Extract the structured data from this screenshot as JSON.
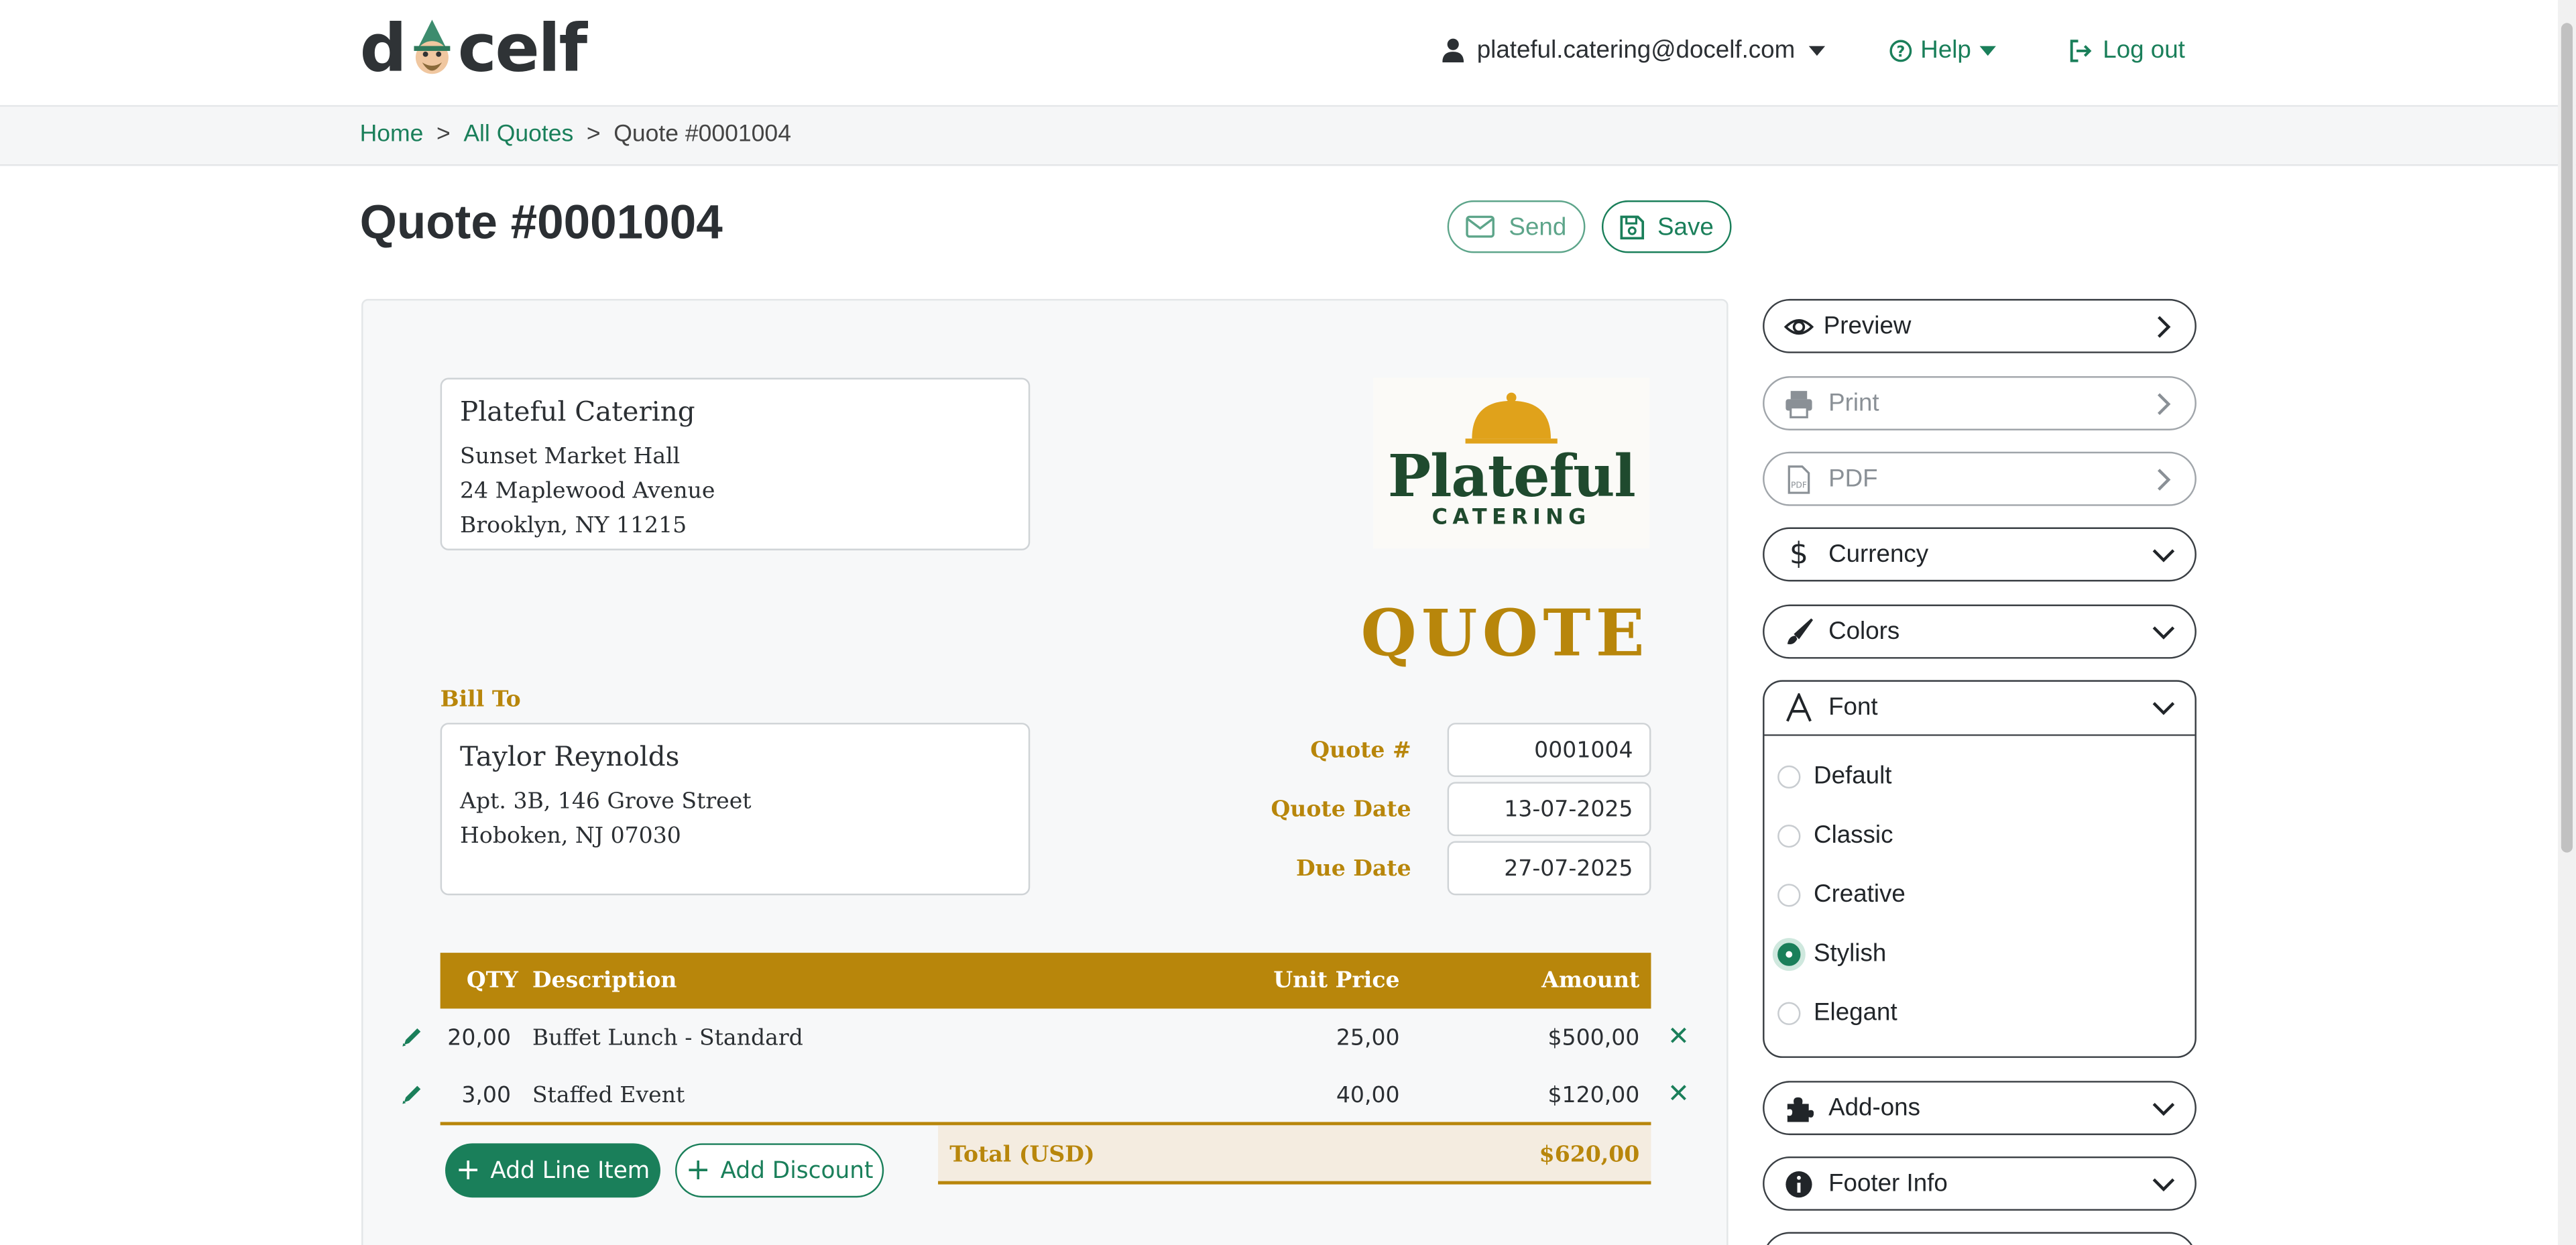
{
  "header": {
    "logo_left": "d",
    "logo_right": "celf",
    "user_email": "plateful.catering@docelf.com",
    "help_label": "Help",
    "logout_label": "Log out"
  },
  "breadcrumb": {
    "home": "Home",
    "all_quotes": "All Quotes",
    "current": "Quote #0001004",
    "separator": ">"
  },
  "page": {
    "title": "Quote #0001004",
    "send_label": "Send",
    "save_label": "Save"
  },
  "document": {
    "from": {
      "name": "Plateful Catering",
      "lines": [
        "Sunset Market Hall",
        "24 Maplewood Avenue",
        "Brooklyn, NY 11215"
      ]
    },
    "brand_logo": {
      "word": "Plateful",
      "sub": "CATERING"
    },
    "doc_type": "QUOTE",
    "bill_to_label": "Bill To",
    "bill_to": {
      "name": "Taylor Reynolds",
      "lines": [
        "Apt. 3B, 146 Grove Street",
        "Hoboken, NJ 07030"
      ]
    },
    "meta": {
      "quote_no_label": "Quote #",
      "quote_no": "0001004",
      "quote_date_label": "Quote Date",
      "quote_date": "13-07-2025",
      "due_date_label": "Due Date",
      "due_date": "27-07-2025"
    },
    "table": {
      "headers": {
        "qty": "QTY",
        "description": "Description",
        "unit_price": "Unit Price",
        "amount": "Amount"
      },
      "rows": [
        {
          "qty": "20,00",
          "description": "Buffet Lunch - Standard",
          "unit_price": "25,00",
          "amount": "$500,00"
        },
        {
          "qty": "3,00",
          "description": "Staffed Event",
          "unit_price": "40,00",
          "amount": "$120,00"
        }
      ]
    },
    "add_line_item_label": "Add Line Item",
    "add_discount_label": "Add Discount",
    "total_label": "Total (USD)",
    "total_value": "$620,00"
  },
  "sidebar": {
    "preview": "Preview",
    "print": "Print",
    "pdf": "PDF",
    "currency": "Currency",
    "colors": "Colors",
    "font": "Font",
    "font_options": [
      "Default",
      "Classic",
      "Creative",
      "Stylish",
      "Elegant"
    ],
    "font_selected": "Stylish",
    "addons": "Add-ons",
    "footer_info": "Footer Info"
  },
  "colors": {
    "accent_green": "#1a7f5a",
    "gold": "#b8860b"
  }
}
